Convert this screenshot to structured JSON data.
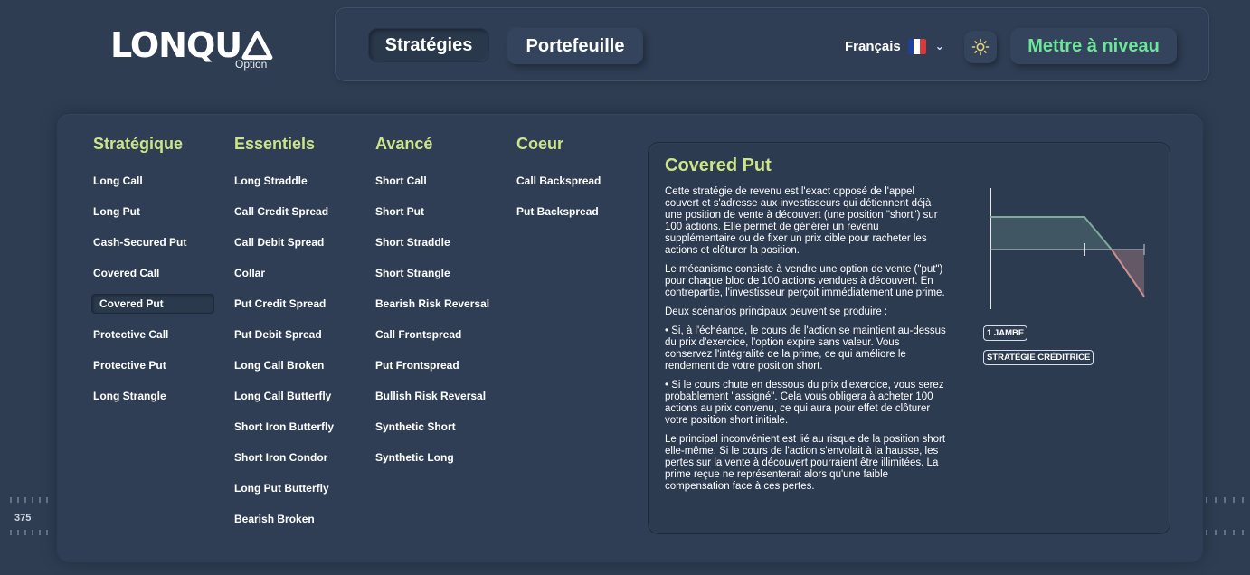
{
  "logo": {
    "word": "LONQU",
    "sub": "Option"
  },
  "nav": {
    "strategies": "Stratégies",
    "portfolio": "Portefeuille"
  },
  "header": {
    "language": "Français",
    "flag_colors": [
      "#1f3f9a",
      "#ffffff",
      "#d63a3a"
    ],
    "theme_icon": "sun-icon",
    "upgrade": "Mettre à niveau"
  },
  "columns": [
    {
      "heading": "Stratégique",
      "items": [
        "Long Call",
        "Long Put",
        "Cash-Secured Put",
        "Covered Call",
        "Covered Put",
        "Protective Call",
        "Protective Put",
        "Long Strangle"
      ]
    },
    {
      "heading": "Essentiels",
      "items": [
        "Long Straddle",
        "Call Credit Spread",
        "Call Debit Spread",
        "Collar",
        "Put Credit Spread",
        "Put Debit Spread",
        "Long Call Broken",
        "Long Call Butterfly",
        "Short Iron Butterfly",
        "Short Iron Condor",
        "Long Put Butterfly",
        "Bearish Broken"
      ]
    },
    {
      "heading": "Avancé",
      "items": [
        "Short Call",
        "Short Put",
        "Short Straddle",
        "Short Strangle",
        "Bearish Risk Reversal",
        "Call Frontspread",
        "Put Frontspread",
        "Bullish Risk Reversal",
        "Synthetic Short",
        "Synthetic Long"
      ]
    },
    {
      "heading": "Coeur",
      "items": [
        "Call Backspread",
        "Put Backspread"
      ]
    }
  ],
  "selected": "Covered Put",
  "detail": {
    "title": "Covered Put",
    "paragraphs": [
      "Cette stratégie de revenu est l'exact opposé de l'appel couvert et s'adresse aux investisseurs qui détiennent déjà une position de vente à découvert (une position \"short\") sur 100 actions. Elle permet de générer un revenu supplémentaire ou de fixer un prix cible pour racheter les actions et clôturer la position.",
      "Le mécanisme consiste à vendre une option de vente (\"put\") pour chaque bloc de 100 actions vendues à découvert. En contrepartie, l'investisseur perçoit immédiatement une prime.",
      "Deux scénarios principaux peuvent se produire :",
      "• Si, à l'échéance, le cours de l'action se maintient au-dessus du prix d'exercice, l'option expire sans valeur. Vous conservez l'intégralité de la prime, ce qui améliore le rendement de votre position short.",
      "• Si le cours chute en dessous du prix d'exercice, vous serez probablement \"assigné\". Cela vous obligera à acheter 100 actions au prix convenu, ce qui aura pour effet de clôturer votre position short initiale.",
      "Le principal inconvénient est lié au risque de la position short elle-même. Si le cours de l'action s'envolait à la hausse, les pertes sur la vente à découvert pourraient être illimitées. La prime reçue ne représenterait alors qu'une faible compensation face à ces pertes."
    ],
    "badges": [
      "1 JAMBE",
      "STRATÉGIE CRÉDITRICE"
    ],
    "profit_color": "#7fa99a",
    "loss_color": "#c98f8f"
  },
  "side_value": "375"
}
